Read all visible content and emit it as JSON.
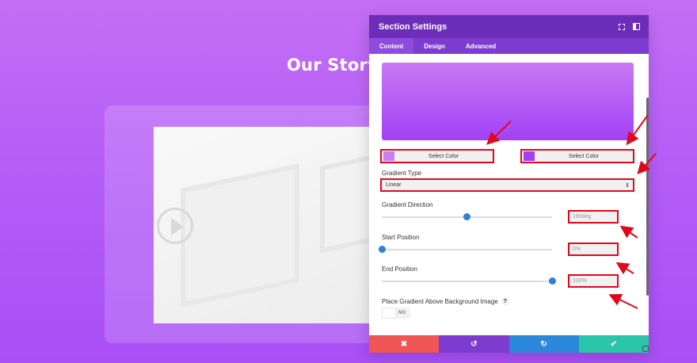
{
  "page": {
    "heading": "Our Story"
  },
  "modal": {
    "title": "Section Settings",
    "tabs": [
      {
        "label": "Content",
        "active": true
      },
      {
        "label": "Design",
        "active": false
      },
      {
        "label": "Advanced",
        "active": false
      }
    ],
    "gradient_preview": {
      "start_color": "#c979f4",
      "end_color": "#a241f6"
    },
    "color_pickers": [
      {
        "label": "Select Color",
        "swatch": "#c97ef4"
      },
      {
        "label": "Select Color",
        "swatch": "#a33ef5"
      }
    ],
    "gradient_type": {
      "label": "Gradient Type",
      "value": "Linear",
      "arrow": "⇕"
    },
    "gradient_direction": {
      "label": "Gradient Direction",
      "value": "180deg",
      "fraction": 0.5
    },
    "start_position": {
      "label": "Start Position",
      "value": "0%",
      "fraction": 0.0
    },
    "end_position": {
      "label": "End Position",
      "value": "100%",
      "fraction": 1.0
    },
    "place_above": {
      "label": "Place Gradient Above Background Image",
      "help": "?",
      "toggle_text": "NO"
    },
    "footer": {
      "cancel": "✖",
      "undo": "↺",
      "redo": "↻",
      "save": "✔"
    }
  },
  "colors": {
    "header": "#6c2eb9",
    "tabs": "#7e3bd0",
    "highlight": "#e0081c",
    "slider": "#2f82d0"
  }
}
